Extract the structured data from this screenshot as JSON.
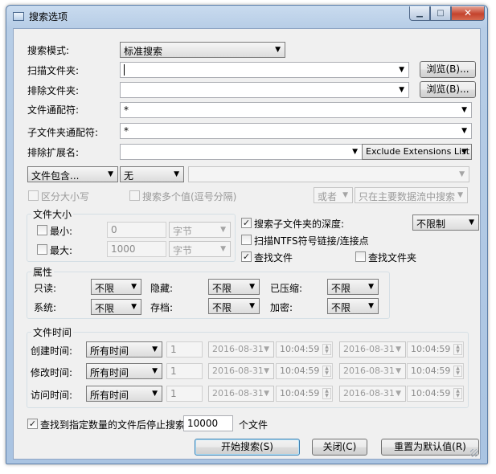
{
  "window": {
    "title": "搜索选项",
    "min": "▁",
    "max": "□",
    "close": "✕"
  },
  "form": {
    "mode_label": "搜索模式:",
    "mode_value": "标准搜索",
    "scan_label": "扫描文件夹:",
    "scan_value": "",
    "browse_label": "浏览(B)...",
    "exclude_folder_label": "排除文件夹:",
    "exclude_folder_value": "",
    "browse2_label": "浏览(B)...",
    "wildcard_label": "文件通配符:",
    "wildcard_value": "*",
    "subfolder_wildcard_label": "子文件夹通配符:",
    "subfolder_wildcard_value": "*",
    "exclude_ext_label": "排除扩展名:",
    "exclude_ext_value": "",
    "exclude_ext_list": "Exclude Extensions List",
    "contains_mode": "文件包含...",
    "contains_option": "无",
    "contains_value": ""
  },
  "options": {
    "case_sensitive": "区分大小写",
    "multi_values": "搜索多个值(逗号分隔)",
    "logic_value": "或者",
    "stream_value": "只在主要数据流中搜索"
  },
  "size": {
    "title": "文件大小",
    "min_label": "最小:",
    "min_value": "0",
    "min_unit": "字节",
    "max_label": "最大:",
    "max_value": "1000",
    "max_unit": "字节"
  },
  "folder_opts": {
    "subfolder_depth_label": "搜索子文件夹的深度:",
    "depth_value": "不限制",
    "scan_ntfs_label": "扫描NTFS符号链接/连接点",
    "find_files_label": "查找文件",
    "find_folders_label": "查找文件夹"
  },
  "attributes": {
    "title": "属性",
    "readonly_label": "只读:",
    "readonly_value": "不限",
    "hidden_label": "隐藏:",
    "hidden_value": "不限",
    "compressed_label": "已压缩:",
    "compressed_value": "不限",
    "system_label": "系统:",
    "system_value": "不限",
    "archive_label": "存档:",
    "archive_value": "不限",
    "encrypted_label": "加密:",
    "encrypted_value": "不限"
  },
  "filetime": {
    "title": "文件时间",
    "rows": [
      {
        "label": "创建时间:",
        "range": "所有时间",
        "count": "1",
        "from_date": "2016-08-31",
        "from_time": "10:04:59",
        "to_date": "2016-08-31",
        "to_time": "10:04:59"
      },
      {
        "label": "修改时间:",
        "range": "所有时间",
        "count": "1",
        "from_date": "2016-08-31",
        "from_time": "10:04:59",
        "to_date": "2016-08-31",
        "to_time": "10:04:59"
      },
      {
        "label": "访问时间:",
        "range": "所有时间",
        "count": "1",
        "from_date": "2016-08-31",
        "from_time": "10:04:59",
        "to_date": "2016-08-31",
        "to_time": "10:04:59"
      }
    ]
  },
  "stop": {
    "label": "查找到指定数量的文件后停止搜索",
    "value": "10000",
    "unit": "个文件"
  },
  "buttons": {
    "start": "开始搜索(S)",
    "close": "关闭(C)",
    "reset": "重置为默认值(R)"
  },
  "glyphs": {
    "arrow": "▼",
    "check": "✓",
    "spin_up": "▲",
    "spin_down": "▼"
  }
}
